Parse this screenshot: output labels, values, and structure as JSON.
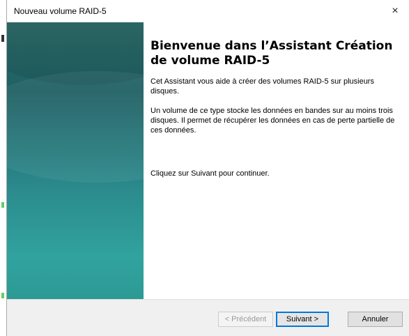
{
  "window": {
    "title": "Nouveau volume RAID-5",
    "close_glyph": "×"
  },
  "content": {
    "heading": "Bienvenue dans l’Assistant Création de volume RAID-5",
    "paragraph1": "Cet Assistant vous aide à créer des volumes RAID-5 sur plusieurs disques.",
    "paragraph2": "Un volume de ce type stocke les données en bandes sur au moins trois disques. Il permet de récupérer les données en cas de perte partielle de ces données.",
    "paragraph3": "Cliquez sur Suivant pour continuer."
  },
  "buttons": {
    "previous": "< Précédent",
    "next": "Suivant >",
    "cancel": "Annuler"
  },
  "colors": {
    "panel_dark": "#1e5f63",
    "panel_light": "#31a39e",
    "focus_border": "#0078d7"
  },
  "icons": {
    "close": "close-icon"
  }
}
